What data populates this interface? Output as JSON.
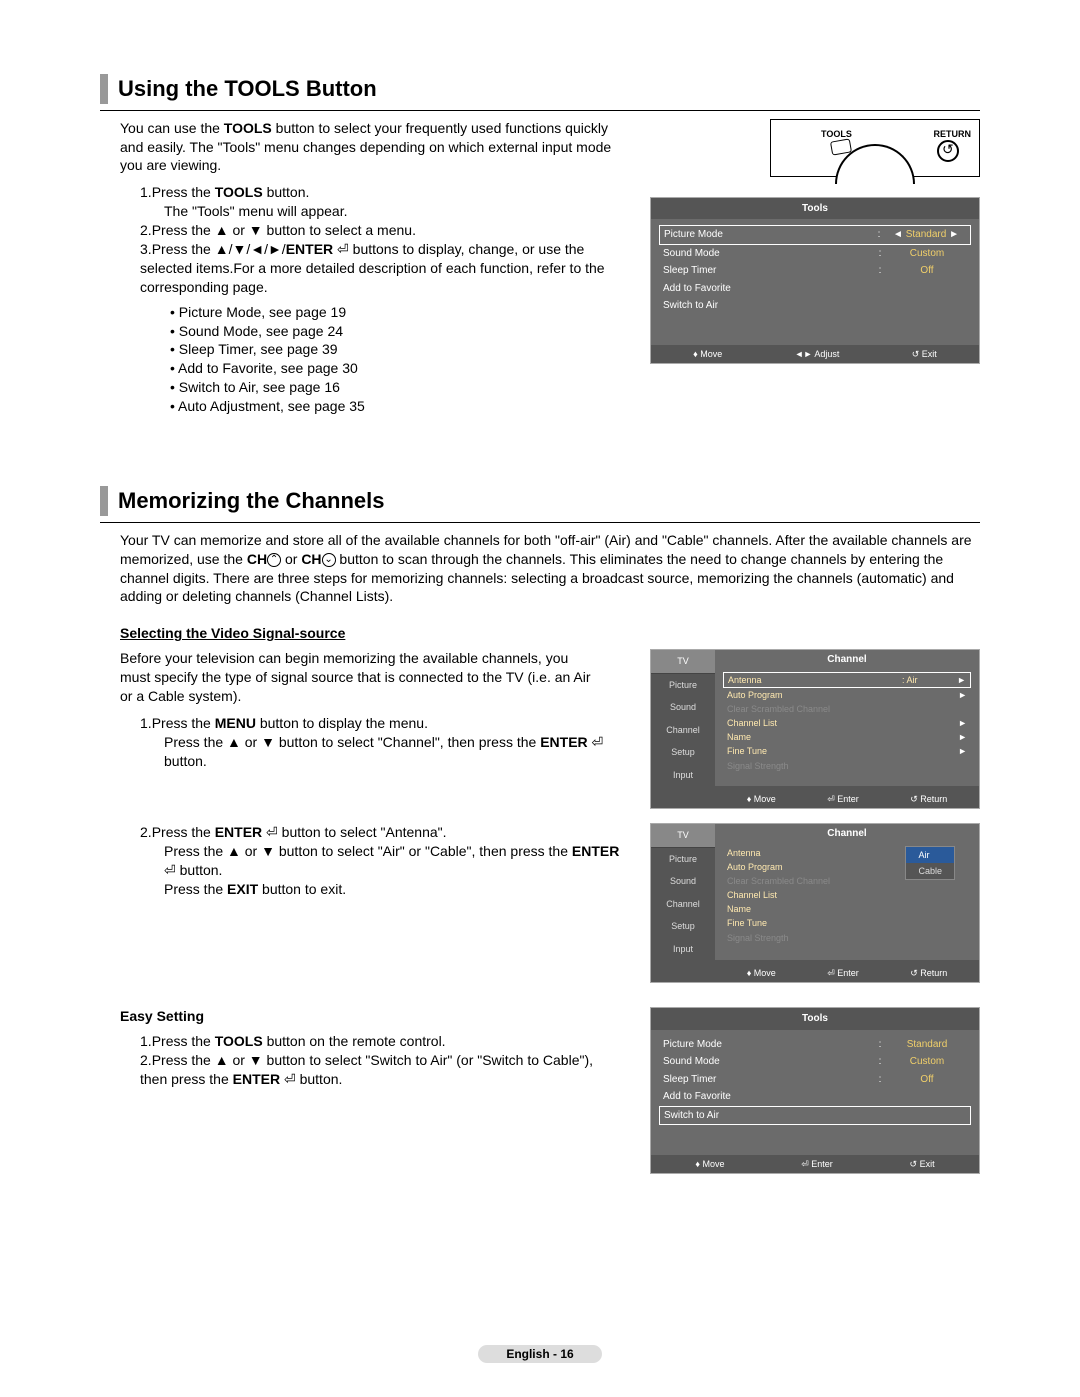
{
  "section1": {
    "title": "Using the TOOLS Button",
    "intro_a": "You can use the ",
    "intro_bold": "TOOLS",
    "intro_b": " button to select your frequently used functions quickly and easily. The \"Tools\" menu changes depending on which external input mode you are viewing.",
    "step1_a": "Press the ",
    "step1_bold": "TOOLS",
    "step1_b": " button.",
    "step1_c": "The \"Tools\" menu will appear.",
    "step2": "Press the ▲ or ▼ button to select a menu.",
    "step3_a": "Press the ▲/▼/◄/►/",
    "step3_bold": "ENTER",
    "step3_b": " buttons to display, change, or use the selected items.For a more detailed description of each function, refer to the corresponding page.",
    "bullets": [
      "Picture Mode, see page 19",
      "Sound Mode, see page 24",
      "Sleep Timer, see page 39",
      "Add to Favorite, see page 30",
      "Switch to Air, see page 16",
      "Auto Adjustment, see page 35"
    ],
    "remote": {
      "tools": "TOOLS",
      "return": "RETURN"
    },
    "tools_osd": {
      "title": "Tools",
      "rows": [
        {
          "k": "Picture Mode",
          "v": "Standard",
          "sel": true
        },
        {
          "k": "Sound Mode",
          "v": "Custom"
        },
        {
          "k": "Sleep Timer",
          "v": "Off"
        },
        {
          "k": "Add to Favorite",
          "v": ""
        },
        {
          "k": "Switch to Air",
          "v": ""
        }
      ],
      "footer": {
        "a": "♦ Move",
        "b": "◄► Adjust",
        "c": "↺ Exit"
      }
    }
  },
  "section2": {
    "title": "Memorizing the Channels",
    "intro_a": "Your TV can memorize and store all of the available channels for both \"off-air\" (Air) and \"Cable\" channels. After the available channels are memorized, use the ",
    "intro_bold1": "CH",
    "intro_mid": " or ",
    "intro_bold2": "CH",
    "intro_b": " button to scan through the channels. This eliminates the need to change channels by entering the channel digits. There are three steps for memorizing channels: selecting a broadcast source, memorizing the channels (automatic) and adding or deleting channels (Channel Lists).",
    "subhead": "Selecting the Video Signal-source",
    "prelude": "Before your television can begin memorizing the available channels, you must specify the type of signal source that is connected to the TV (i.e. an Air or a Cable system).",
    "step1_a": "Press the ",
    "step1_bold": "MENU",
    "step1_b": " button to display the menu.",
    "step1_c_a": "Press the ▲ or ▼ button to select \"Channel\", then press the ",
    "step1_c_bold": "ENTER",
    "step1_c_b": " button.",
    "step2_a": "Press the ",
    "step2_bold": "ENTER",
    "step2_b": " button to select \"Antenna\".",
    "step2_c_a": "Press the ▲ or ▼ button to select \"Air\" or \"Cable\", then press the ",
    "step2_c_bold": "ENTER",
    "step2_c_b": " button.",
    "step2_d_a": "Press the ",
    "step2_d_bold": "EXIT",
    "step2_d_b": " button to exit.",
    "osd1": {
      "tv": "TV",
      "title": "Channel",
      "tabs": [
        "Picture",
        "Sound",
        "Channel",
        "Setup",
        "Input"
      ],
      "rows": [
        {
          "k": "Antenna",
          "v": ": Air",
          "sel": true,
          "arrow": true
        },
        {
          "k": "Auto Program",
          "arrow": true
        },
        {
          "k": "Clear Scrambled Channel",
          "dim": true
        },
        {
          "k": "Channel List",
          "arrow": true
        },
        {
          "k": "Name",
          "arrow": true
        },
        {
          "k": "Fine Tune",
          "arrow": true
        },
        {
          "k": "Signal Strength",
          "dim": true
        }
      ],
      "footer": {
        "a": "♦ Move",
        "b": "⏎ Enter",
        "c": "↺ Return"
      }
    },
    "osd2": {
      "tv": "TV",
      "title": "Channel",
      "tabs": [
        "Picture",
        "Sound",
        "Channel",
        "Setup",
        "Input"
      ],
      "rows": [
        {
          "k": "Antenna",
          "v": ":",
          "sel": false
        },
        {
          "k": "Auto Program"
        },
        {
          "k": "Clear Scrambled Channel",
          "dim": true
        },
        {
          "k": "Channel List"
        },
        {
          "k": "Name"
        },
        {
          "k": "Fine Tune"
        },
        {
          "k": "Signal Strength",
          "dim": true
        }
      ],
      "dropdown": {
        "opts": [
          "Air",
          "Cable"
        ],
        "sel": "Air"
      },
      "footer": {
        "a": "♦ Move",
        "b": "⏎ Enter",
        "c": "↺ Return"
      }
    },
    "easy": {
      "head": "Easy Setting",
      "step1_a": "Press the ",
      "step1_bold": "TOOLS",
      "step1_b": " button on the remote control.",
      "step2_a": "Press the ▲ or ▼ button to select \"Switch to Air\" (or \"Switch to Cable\"), then press the ",
      "step2_bold": "ENTER",
      "step2_b": " button.",
      "osd": {
        "title": "Tools",
        "rows": [
          {
            "k": "Picture Mode",
            "v": "Standard"
          },
          {
            "k": "Sound Mode",
            "v": "Custom"
          },
          {
            "k": "Sleep Timer",
            "v": "Off"
          },
          {
            "k": "Add to Favorite",
            "v": ""
          },
          {
            "k": "Switch to Air",
            "v": "",
            "sel": true
          }
        ],
        "footer": {
          "a": "♦ Move",
          "b": "⏎ Enter",
          "c": "↺ Exit"
        }
      }
    }
  },
  "page_footer": "English - 16"
}
